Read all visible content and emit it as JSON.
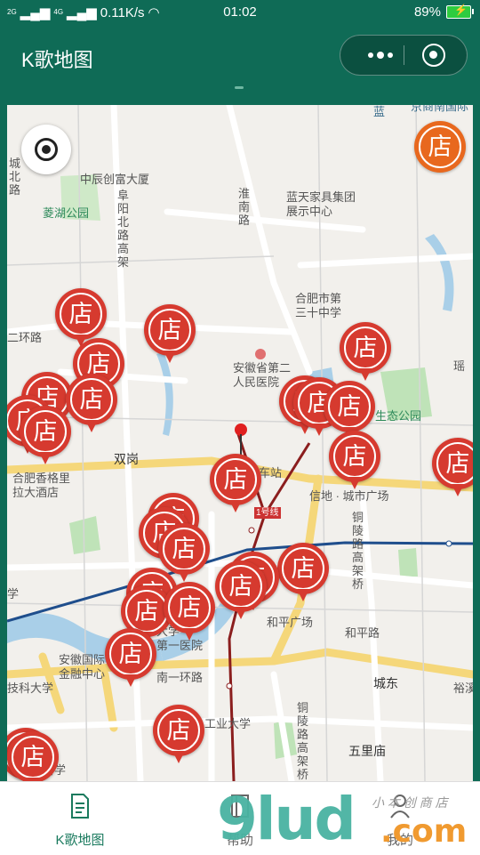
{
  "status_bar": {
    "signal_small": "2G",
    "signal_small2": "4G",
    "net_speed": "0.11K/s",
    "time": "01:02",
    "battery": "89%"
  },
  "nav": {
    "title": "K歌地图"
  },
  "map": {
    "store_label": "店",
    "labels": {
      "zhongchen": "中辰创富大厦",
      "fuyang": "阜\n阳\n北\n路\n高\n架",
      "linghu": "菱湖公园",
      "chengbei": "城\n北\n路",
      "huainan": "淮\n南\n路",
      "lantian": "蓝天家具集团\n展示中心",
      "no30": "合肥市第\n三十中学",
      "erhuan": "二环路",
      "hospital2": "安徽省第二\n人民医院",
      "ecopark": "生态公园",
      "yaohai": "瑶",
      "shuanggang": "双岗",
      "shangri": "合肥香格里\n拉大酒店",
      "station": "火车站",
      "line1": "1号线",
      "xindi": "信地 · 城市广场",
      "tongling": "铜\n陵\n路\n高\n架\n桥",
      "heping_sq": "和平广场",
      "heping_rd": "和平路",
      "hospital1": "大学\n第一医院",
      "intl": "安徽国际\n金融中心",
      "keji": "技科大学",
      "yihuan": "南一环路",
      "chengdong": "城东",
      "yuxi": "裕溪",
      "gongye": "工业大学",
      "wuli": "五里庙",
      "tongling2": "铜\n陵\n路\n高\n架\n桥",
      "xue": "学",
      "school_bottom": "科学",
      "lan": "蓝",
      "jingnan": "京商南国际"
    }
  },
  "tabs": [
    {
      "label": "K歌地图",
      "icon": "map-doc-icon"
    },
    {
      "label": "帮助",
      "icon": "help-book-icon"
    },
    {
      "label": "我的",
      "icon": "user-icon"
    }
  ],
  "watermark": {
    "big": "9lud",
    "com": ".com",
    "small": "小 本 创 商 店"
  },
  "colors": {
    "brand": "#0f6b56",
    "marker": "#d63a2f",
    "marker_alt": "#e8681e",
    "active_tab": "#1a7a5e"
  }
}
